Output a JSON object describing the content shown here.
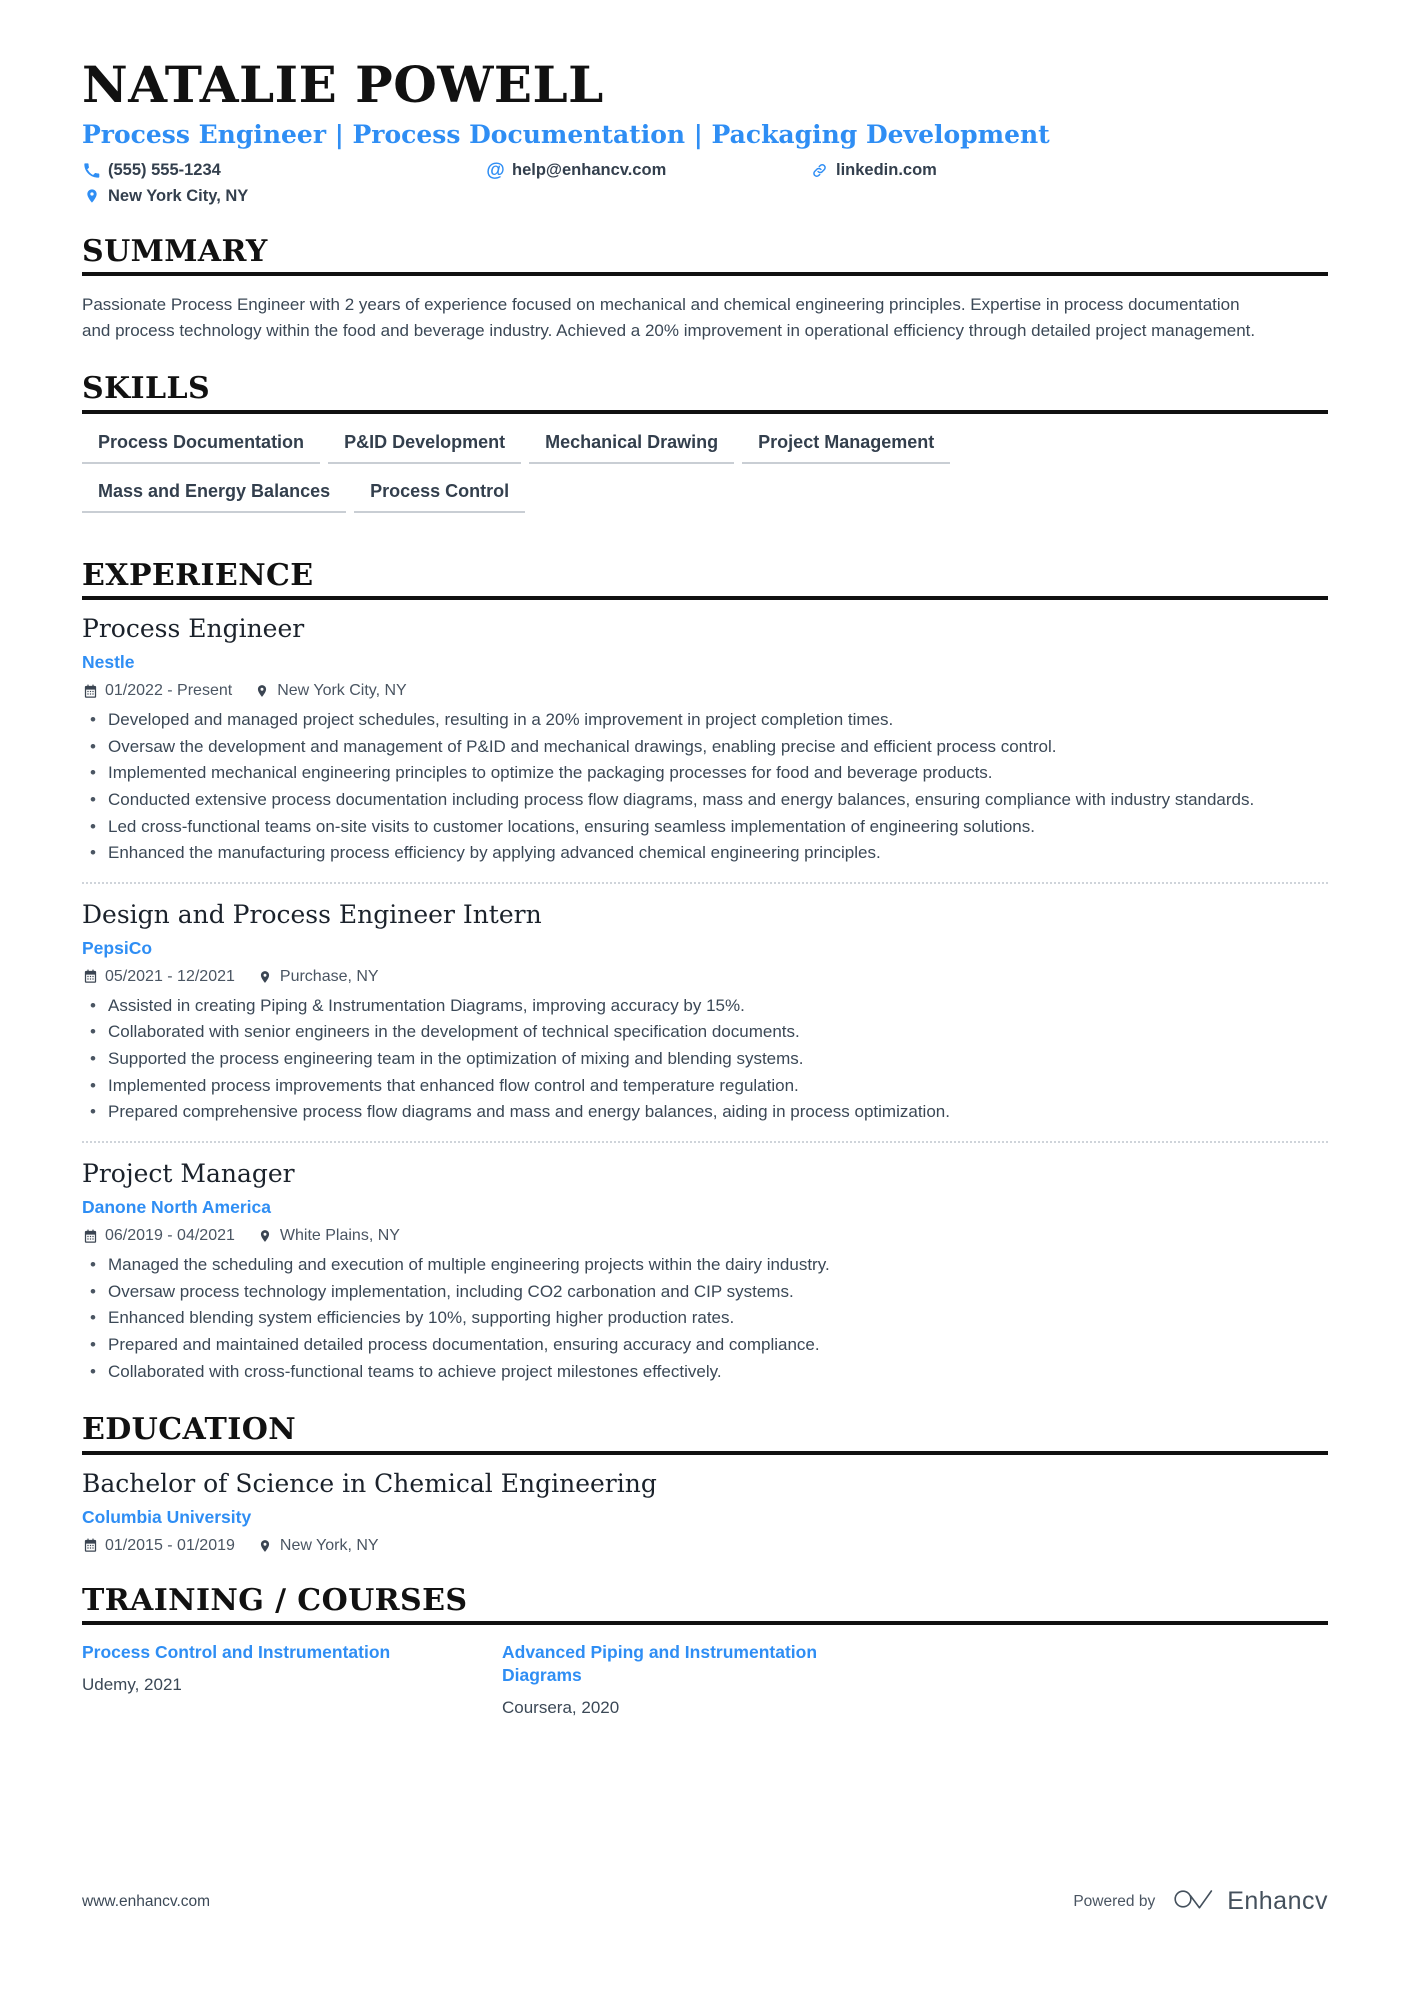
{
  "header": {
    "name": "NATALIE POWELL",
    "headline": "Process Engineer | Process Documentation | Packaging Development",
    "contacts": [
      {
        "icon": "phone-icon",
        "text": "(555) 555-1234"
      },
      {
        "icon": "email-icon",
        "text": "help@enhancv.com"
      },
      {
        "icon": "link-icon",
        "text": "linkedin.com"
      },
      {
        "icon": "location-icon",
        "text": "New York City, NY"
      }
    ]
  },
  "sections": {
    "summary": {
      "title": "SUMMARY",
      "text": "Passionate Process Engineer with 2 years of experience focused on mechanical and chemical engineering principles. Expertise in process documentation and process technology within the food and beverage industry. Achieved a 20% improvement in operational efficiency through detailed project management."
    },
    "skills": {
      "title": "SKILLS",
      "items": [
        "Process Documentation",
        "P&ID Development",
        "Mechanical Drawing",
        "Project Management",
        "Mass and Energy Balances",
        "Process Control"
      ]
    },
    "experience": {
      "title": "EXPERIENCE",
      "entries": [
        {
          "role": "Process Engineer",
          "company": "Nestle",
          "dates": "01/2022 - Present",
          "location": "New York City, NY",
          "bullets": [
            "Developed and managed project schedules, resulting in a 20% improvement in project completion times.",
            "Oversaw the development and management of P&ID and mechanical drawings, enabling precise and efficient process control.",
            "Implemented mechanical engineering principles to optimize the packaging processes for food and beverage products.",
            "Conducted extensive process documentation including process flow diagrams, mass and energy balances, ensuring compliance with industry standards.",
            "Led cross-functional teams on-site visits to customer locations, ensuring seamless implementation of engineering solutions.",
            "Enhanced the manufacturing process efficiency by applying advanced chemical engineering principles."
          ]
        },
        {
          "role": "Design and Process Engineer Intern",
          "company": "PepsiCo",
          "dates": "05/2021 - 12/2021",
          "location": "Purchase, NY",
          "bullets": [
            "Assisted in creating Piping & Instrumentation Diagrams, improving accuracy by 15%.",
            "Collaborated with senior engineers in the development of technical specification documents.",
            "Supported the process engineering team in the optimization of mixing and blending systems.",
            "Implemented process improvements that enhanced flow control and temperature regulation.",
            "Prepared comprehensive process flow diagrams and mass and energy balances, aiding in process optimization."
          ]
        },
        {
          "role": "Project Manager",
          "company": "Danone North America",
          "dates": "06/2019 - 04/2021",
          "location": "White Plains, NY",
          "bullets": [
            "Managed the scheduling and execution of multiple engineering projects within the dairy industry.",
            "Oversaw process technology implementation, including CO2 carbonation and CIP systems.",
            "Enhanced blending system efficiencies by 10%, supporting higher production rates.",
            "Prepared and maintained detailed process documentation, ensuring accuracy and compliance.",
            "Collaborated with cross-functional teams to achieve project milestones effectively."
          ]
        }
      ]
    },
    "education": {
      "title": "EDUCATION",
      "entries": [
        {
          "degree": "Bachelor of Science in Chemical Engineering",
          "school": "Columbia University",
          "dates": "01/2015 - 01/2019",
          "location": "New York, NY"
        }
      ]
    },
    "training": {
      "title": "TRAINING / COURSES",
      "courses": [
        {
          "name": "Process Control and Instrumentation",
          "meta": "Udemy, 2021"
        },
        {
          "name": "Advanced Piping and Instrumentation Diagrams",
          "meta": "Coursera, 2020"
        }
      ]
    }
  },
  "footer": {
    "url": "www.enhancv.com",
    "powered_by": "Powered by",
    "brand": "Enhancv"
  },
  "colors": {
    "accent": "#2f8ef4",
    "text": "#3b4856",
    "heading": "#111111"
  }
}
